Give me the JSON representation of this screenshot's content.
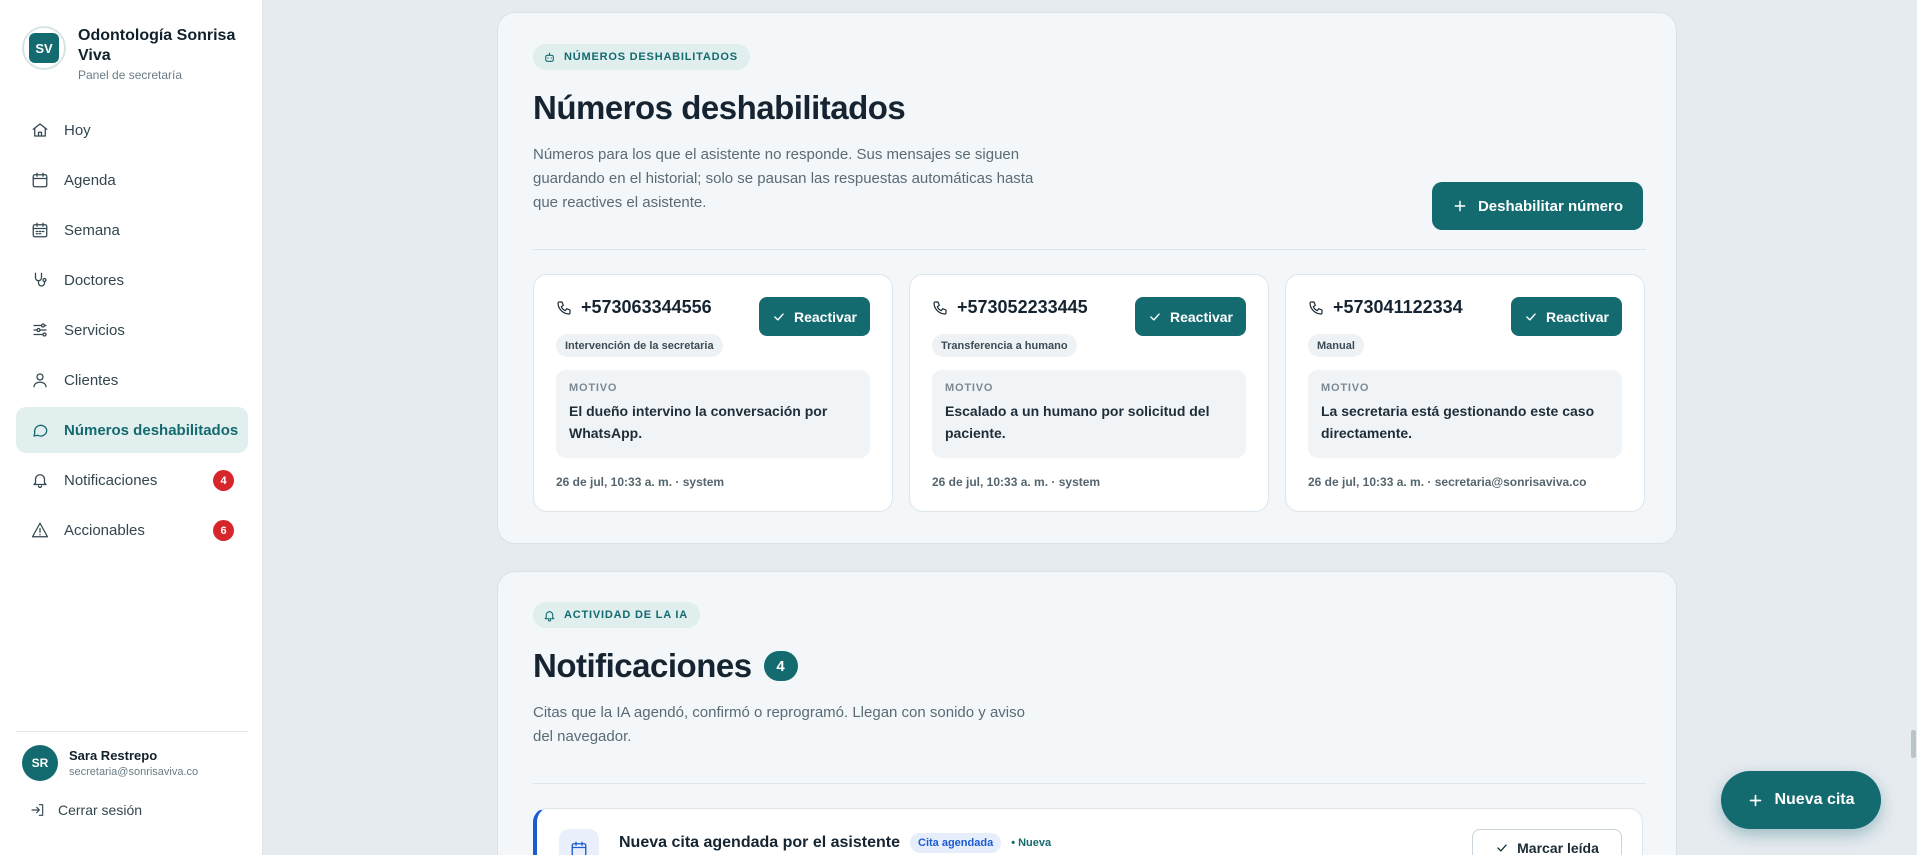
{
  "brand": {
    "initials": "SV",
    "name": "Odontología Sonrisa Viva",
    "subtitle": "Panel de secretaría"
  },
  "nav": [
    {
      "label": "Hoy",
      "icon": "home-icon"
    },
    {
      "label": "Agenda",
      "icon": "calendar-icon"
    },
    {
      "label": "Semana",
      "icon": "calendar-week-icon"
    },
    {
      "label": "Doctores",
      "icon": "stethoscope-icon"
    },
    {
      "label": "Servicios",
      "icon": "sliders-icon"
    },
    {
      "label": "Clientes",
      "icon": "user-icon"
    },
    {
      "label": "Números deshabilitados",
      "icon": "chat-bubble-icon",
      "active": true
    },
    {
      "label": "Notificaciones",
      "icon": "bell-icon",
      "badge": "4"
    },
    {
      "label": "Accionables",
      "icon": "warning-icon",
      "badge": "6"
    }
  ],
  "user": {
    "initials": "SR",
    "name": "Sara Restrepo",
    "email": "secretaria@sonrisaviva.co",
    "logout_label": "Cerrar sesión"
  },
  "disabled": {
    "eyebrow": "NÚMEROS DESHABILITADOS",
    "title": "Números deshabilitados",
    "description": "Números para los que el asistente no responde. Sus mensajes se siguen guardando en el historial; solo se pausan las respuestas automáticas hasta que reactives el asistente.",
    "action_label": "Deshabilitar número",
    "cards": [
      {
        "phone": "+573063344556",
        "button": "Reactivar",
        "tag": "Intervención de la secretaria",
        "reason_label": "MOTIVO",
        "reason": "El dueño intervino la conversación por WhatsApp.",
        "meta": "26 de jul, 10:33 a. m. · system"
      },
      {
        "phone": "+573052233445",
        "button": "Reactivar",
        "tag": "Transferencia a humano",
        "reason_label": "MOTIVO",
        "reason": "Escalado a un humano por solicitud del paciente.",
        "meta": "26 de jul, 10:33 a. m. · system"
      },
      {
        "phone": "+573041122334",
        "button": "Reactivar",
        "tag": "Manual",
        "reason_label": "MOTIVO",
        "reason": "La secretaria está gestionando este caso directamente.",
        "meta": "26 de jul, 10:33 a. m. · secretaria@sonrisaviva.co"
      }
    ]
  },
  "notifications": {
    "eyebrow": "ACTIVIDAD DE LA IA",
    "title": "Notificaciones",
    "count": "4",
    "description": "Citas que la IA agendó, confirmó o reprogramó. Llegan con sonido y aviso del navegador.",
    "items": [
      {
        "title": "Nueva cita agendada por el asistente",
        "tag": "Cita agendada",
        "status": "• Nueva",
        "button": "Marcar leída"
      }
    ]
  },
  "fab_label": "Nueva cita",
  "colors": {
    "primary": "#136a6f",
    "badge": "#d6262b",
    "notif_accent": "#1d5bd1"
  }
}
